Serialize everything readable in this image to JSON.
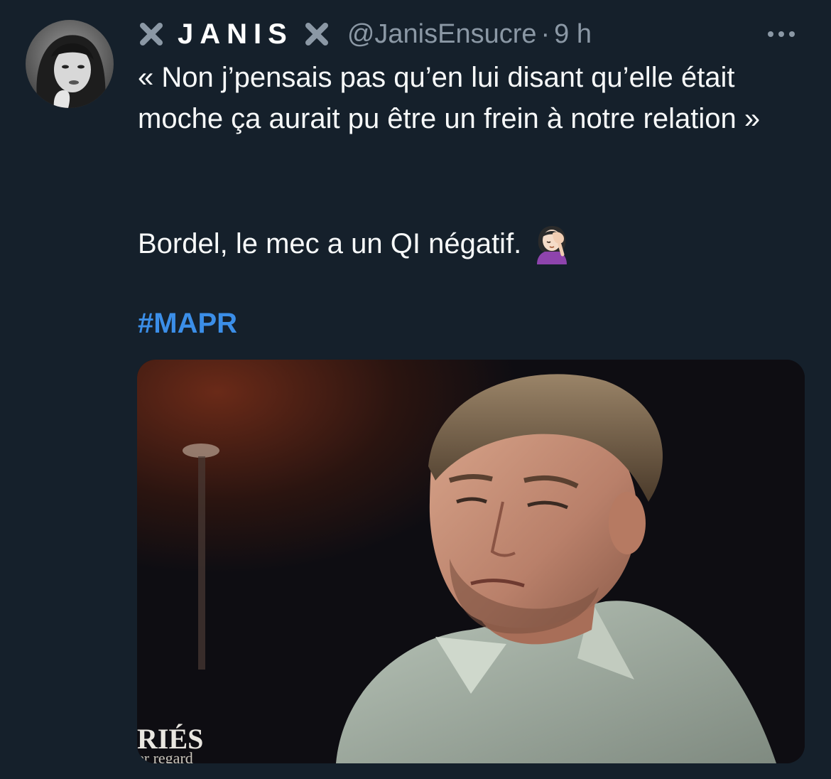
{
  "tweet": {
    "author": {
      "display_name": "JANIS",
      "handle": "@JanisEnsucre",
      "separator": "·",
      "time": "9 h",
      "name_decoration_icon": "cross-mark-icon"
    },
    "text": {
      "line1": "« Non j’pensais pas qu’en lui disant qu’elle était moche ça aurait pu être un frein à notre relation »",
      "line2": "Bordel, le mec a un QI négatif.",
      "emoji": "woman-facepalming-emoji"
    },
    "hashtag": "#MAPR",
    "media": {
      "watermark_main": "RIÉS",
      "watermark_sub": "er regard"
    },
    "more_icon": "ellipsis-icon"
  },
  "colors": {
    "background": "#15202b",
    "text_primary": "#f7f9f9",
    "text_secondary": "#8b98a5",
    "link": "#3b8ee8"
  }
}
